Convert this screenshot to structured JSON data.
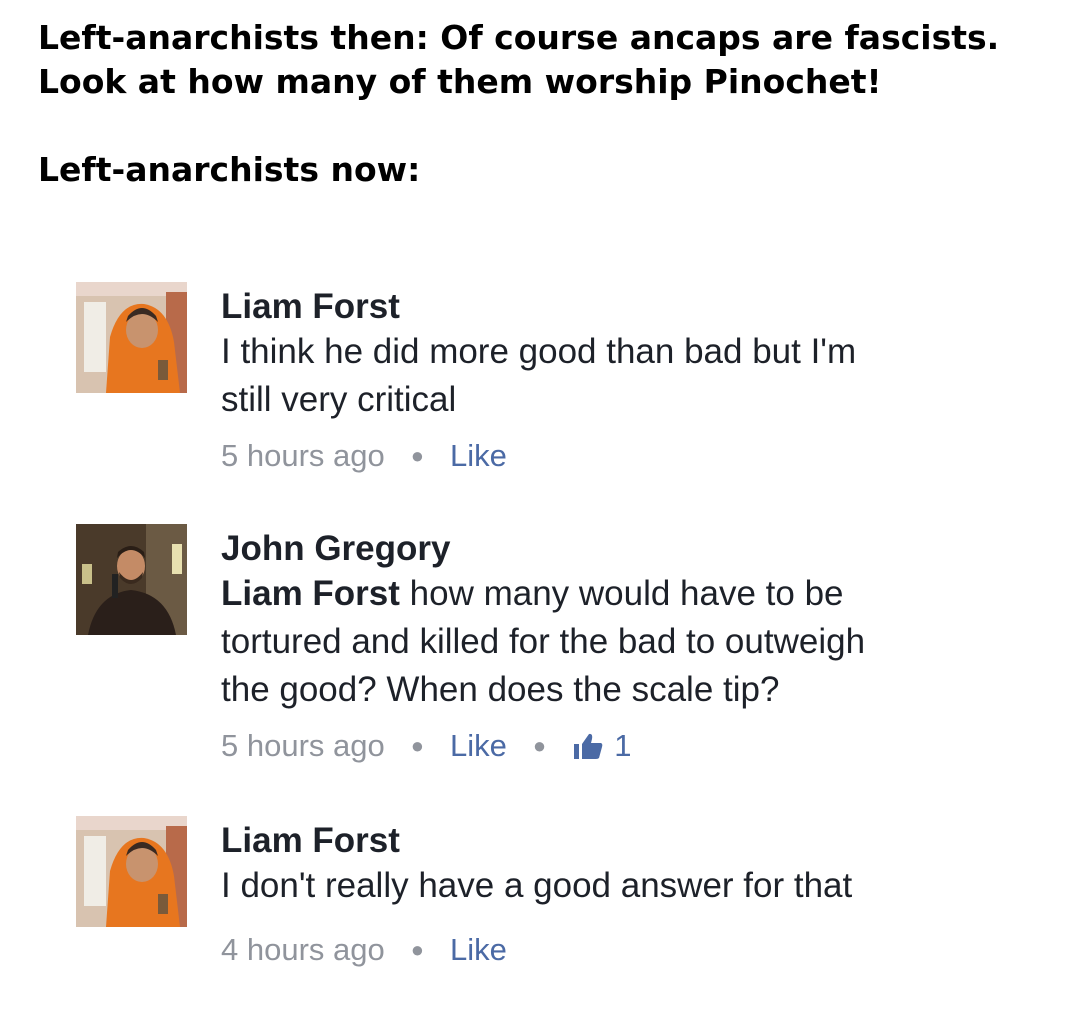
{
  "caption": {
    "line1": "Left-anarchists then: Of course ancaps are fascists.",
    "line2": "Look at how many of them worship Pinochet!",
    "line3": "Left-anarchists now:"
  },
  "comments": [
    {
      "author": "Liam Forst",
      "mention": "",
      "text": "I think he did more good than bad but I'm\nstill very critical",
      "time": "5 hours ago",
      "like_label": "Like"
    },
    {
      "author": "John Gregory",
      "mention": "Liam Forst",
      "text": " how many would have to be\ntortured and killed for the bad to outweigh\nthe good? When does the scale tip?",
      "time": "5 hours ago",
      "like_label": "Like",
      "like_count": "1"
    },
    {
      "author": "Liam Forst",
      "mention": "",
      "text": "I don't really have a good answer for that",
      "time": "4 hours ago",
      "like_label": "Like"
    }
  ],
  "colors": {
    "text": "#1d2129",
    "meta": "#90949c",
    "link": "#4b6aa5"
  }
}
